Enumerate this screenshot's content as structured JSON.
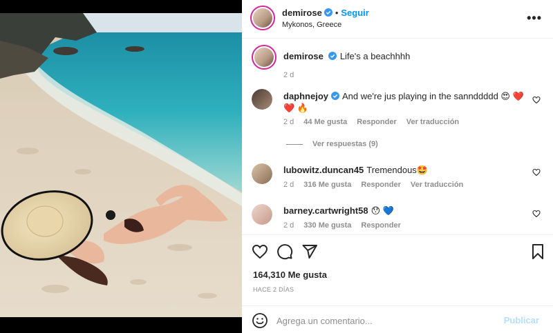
{
  "post": {
    "author": "demirose",
    "follow_label": "Seguir",
    "dot": "•",
    "location": "Mykonos, Greece",
    "more_icon": "more-horizontal-icon"
  },
  "caption": {
    "username": "demirose",
    "text": "Life's a beachhhh",
    "time": "2 d"
  },
  "comments": [
    {
      "username": "daphnejoy",
      "text": "And we're jus playing in the sannddddd 😍 ❤️",
      "text2": "❤️ 🔥",
      "time": "2 d",
      "likes": "44 Me gusta",
      "reply": "Responder",
      "translate": "Ver traducción",
      "view_replies": "Ver respuestas (9)"
    },
    {
      "username": "lubowitz.duncan45",
      "text": "Tremendous🤩",
      "time": "2 d",
      "likes": "316 Me gusta",
      "reply": "Responder",
      "translate": "Ver traducción"
    },
    {
      "username": "barney.cartwright58",
      "text": "😯 💙",
      "time": "2 d",
      "likes": "330 Me gusta",
      "reply": "Responder"
    }
  ],
  "stats": {
    "likes": "164,310 Me gusta",
    "ago": "HACE 2 DÍAS"
  },
  "add_comment": {
    "placeholder": "Agrega un comentario...",
    "post_label": "Publicar"
  },
  "colors": {
    "link_blue": "#0095f6",
    "post_disabled": "#b2dffc",
    "verified": "#3897f0",
    "muted": "#8e8e8e"
  }
}
